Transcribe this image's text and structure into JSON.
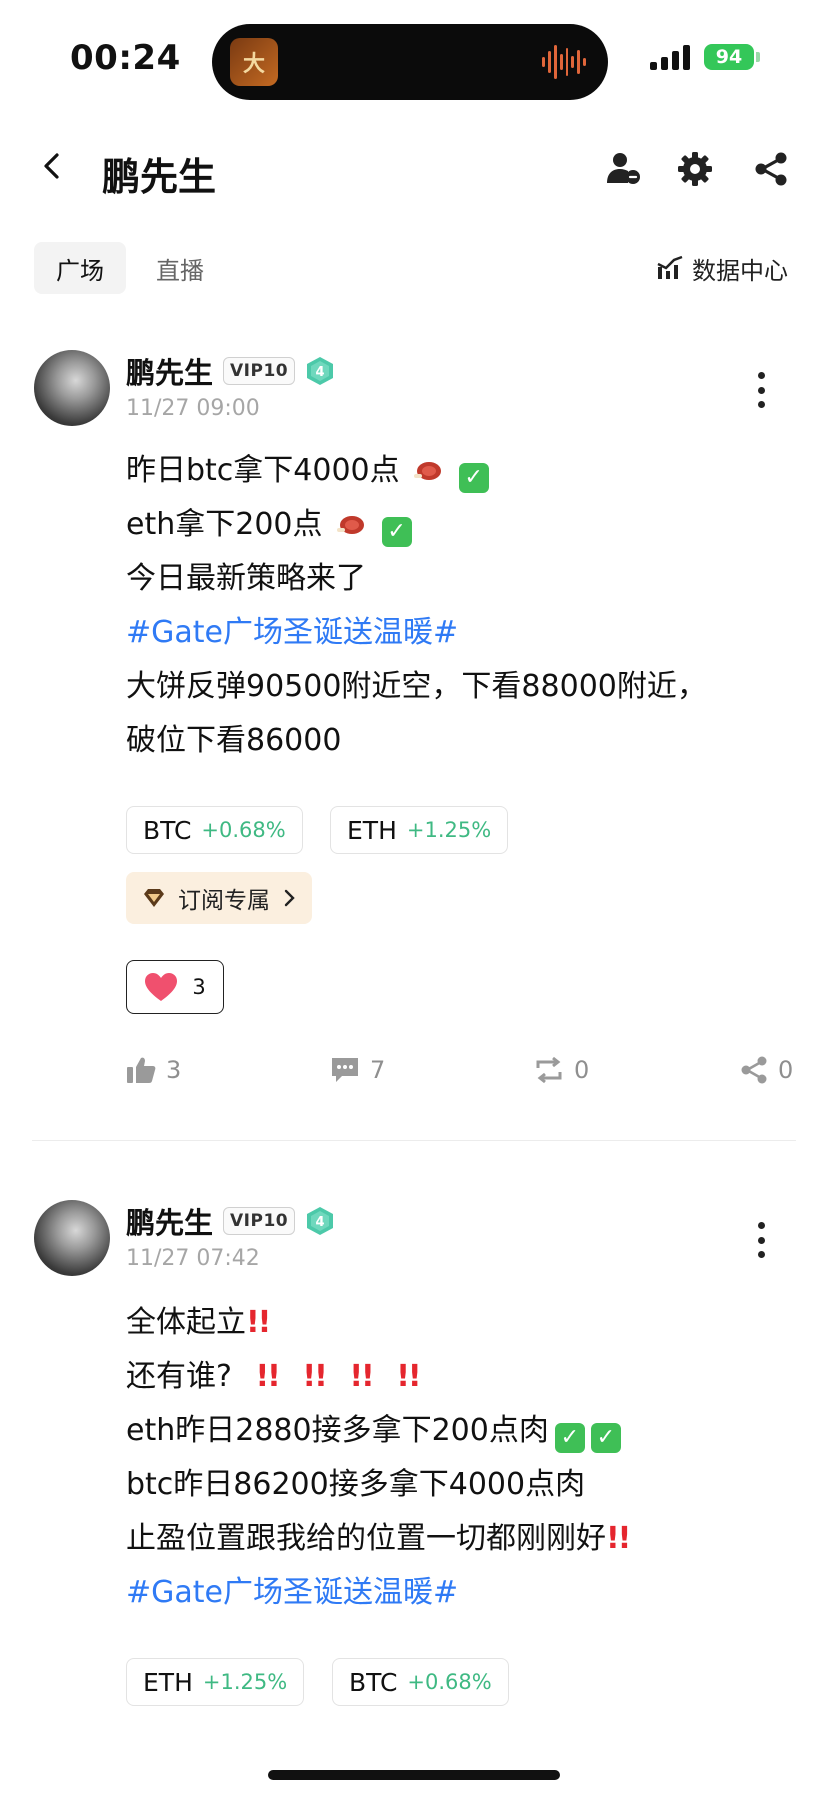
{
  "status_bar": {
    "time": "00:24",
    "battery": "94",
    "island_app": "大"
  },
  "header": {
    "title": "鹏先生"
  },
  "tabs": [
    {
      "label": "广场",
      "active": true
    },
    {
      "label": "直播",
      "active": false
    }
  ],
  "data_center": {
    "label": "数据中心"
  },
  "colors": {
    "accent_link": "#2f7af5",
    "gain_green": "#3fb983",
    "check_green": "#3fbf56",
    "warn_red": "#e5262e"
  },
  "posts": [
    {
      "author": "鹏先生",
      "vip": "VIP10",
      "level": "4",
      "time": "11/27 09:00",
      "lines": [
        "昨日btc拿下4000点",
        "eth拿下200点",
        "今日最新策略来了",
        "#Gate广场圣诞送温暖#",
        "大饼反弹90500附近空，下看88000附近，",
        "破位下看86000"
      ],
      "check_mark": "✓",
      "tickers": [
        {
          "symbol": "BTC",
          "change": "+0.68%"
        },
        {
          "symbol": "ETH",
          "change": "+1.25%"
        }
      ],
      "subscribe": "订阅专属",
      "reaction_count": "3",
      "stats": {
        "likes": "3",
        "comments": "7",
        "reposts": "0",
        "shares": "0"
      }
    },
    {
      "author": "鹏先生",
      "vip": "VIP10",
      "level": "4",
      "time": "11/27 07:42",
      "lines": [
        "全体起立",
        "还有谁?",
        "eth昨日2880接多拿下200点肉",
        "btc昨日86200接多拿下4000点肉",
        "止盈位置跟我给的位置一切都刚刚好",
        "#Gate广场圣诞送温暖#"
      ],
      "bang": "!!",
      "check_mark": "✓",
      "tickers": [
        {
          "symbol": "ETH",
          "change": "+1.25%"
        },
        {
          "symbol": "BTC",
          "change": "+0.68%"
        }
      ]
    }
  ]
}
